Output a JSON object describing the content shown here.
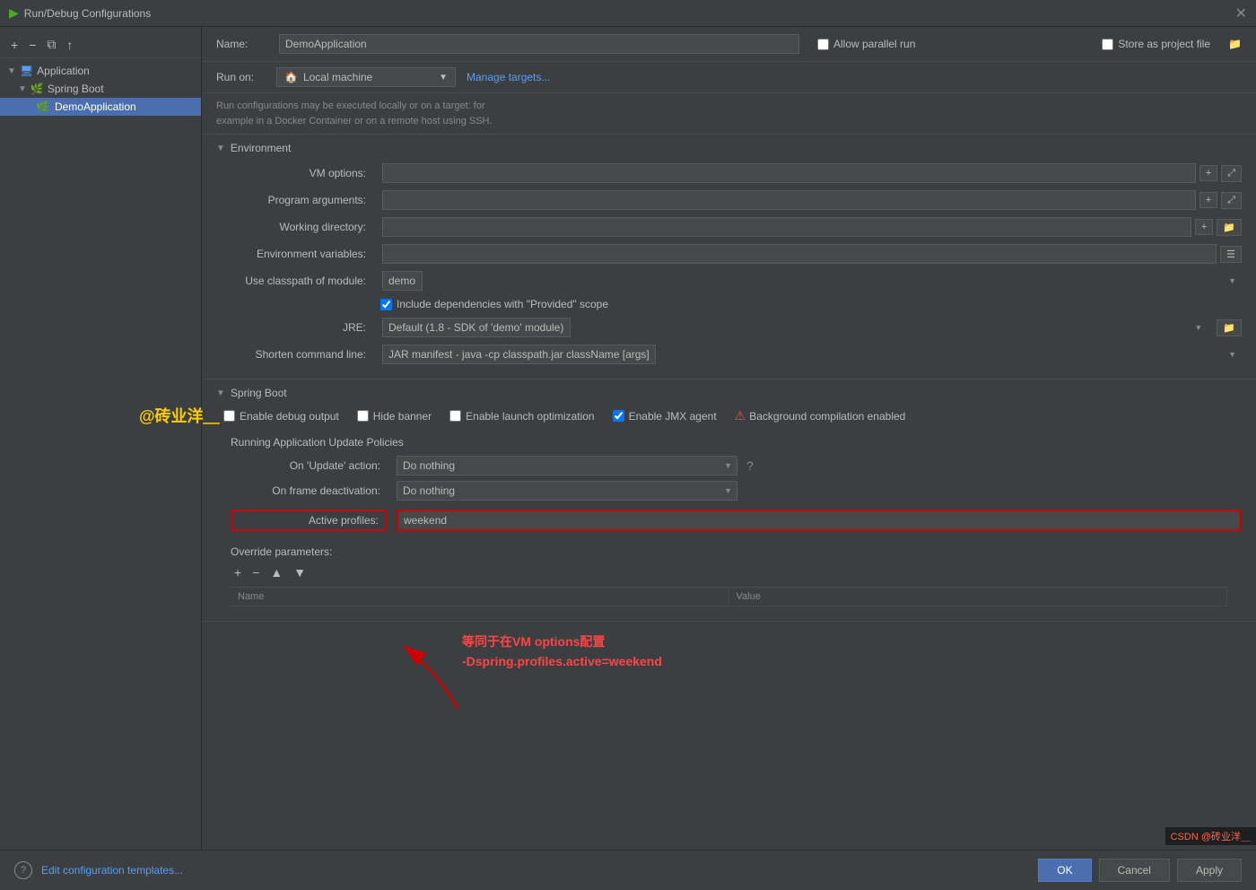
{
  "titleBar": {
    "title": "Run/Debug Configurations",
    "closeBtn": "✕"
  },
  "sidebar": {
    "toolbar": {
      "addBtn": "+",
      "removeBtn": "−",
      "copyBtn": "⧉",
      "moveUpBtn": "↑"
    },
    "items": [
      {
        "id": "application",
        "label": "Application",
        "icon": "🖥",
        "type": "group",
        "expanded": true
      },
      {
        "id": "springboot",
        "label": "Spring Boot",
        "icon": "🌿",
        "type": "group",
        "expanded": true
      },
      {
        "id": "demoapplication",
        "label": "DemoApplication",
        "icon": "🌿",
        "type": "item",
        "selected": true
      }
    ]
  },
  "header": {
    "nameLabel": "Name:",
    "nameValue": "DemoApplication",
    "allowParallelLabel": "Allow parallel run",
    "storeAsProjectLabel": "Store as project file"
  },
  "runOn": {
    "label": "Run on:",
    "target": "Local machine",
    "manageTargets": "Manage targets...",
    "infoText1": "Run configurations may be executed locally or on a target: for",
    "infoText2": "example in a Docker Container or on a remote host using SSH."
  },
  "environment": {
    "sectionTitle": "Environment",
    "vmOptionsLabel": "VM options:",
    "programArgumentsLabel": "Program arguments:",
    "workingDirectoryLabel": "Working directory:",
    "envVariablesLabel": "Environment variables:",
    "classpathLabel": "Use classpath of module:",
    "classpathValue": "demo",
    "includeDepsLabel": "Include dependencies with \"Provided\" scope",
    "jreLabel": "JRE:",
    "jreValue": "Default",
    "jreSuffix": "(1.8 - SDK of 'demo' module)",
    "shortenCmdLabel": "Shorten command line:",
    "shortenCmdValue": "JAR manifest",
    "shortenCmdSuffix": "- java -cp classpath.jar className [args]"
  },
  "springBoot": {
    "sectionTitle": "Spring Boot",
    "enableDebugLabel": "Enable debug output",
    "hideBannerLabel": "Hide banner",
    "enableLaunchLabel": "Enable launch optimization",
    "enableJmxLabel": "Enable JMX agent",
    "bgCompilationLabel": "Background compilation enabled",
    "updatePoliciesTitle": "Running Application Update Policies",
    "onUpdateLabel": "On 'Update' action:",
    "onUpdateValue": "Do nothing",
    "onFrameLabel": "On frame deactivation:",
    "onFrameValue": "Do nothing",
    "activeProfilesLabel": "Active profiles:",
    "activeProfilesValue": "weekend",
    "overrideParamsTitle": "Override parameters:",
    "addBtn": "+",
    "removeBtn": "−",
    "moveUpBtn": "▲",
    "moveDownBtn": "▼",
    "tableNameCol": "Name",
    "tableValueCol": "Value"
  },
  "annotation": {
    "watermark": "@砖业洋＿",
    "arrowText": "等同于在VM options配置\n-Dspring.profiles.active=weekend"
  },
  "bottomBar": {
    "editConfigLink": "Edit configuration templates...",
    "helpBtn": "?",
    "okBtn": "OK",
    "cancelBtn": "Cancel",
    "applyBtn": "Apply"
  },
  "colors": {
    "accent": "#4b6eaf",
    "link": "#589df6",
    "bg": "#3c3f41",
    "inputBg": "#45494a",
    "border": "#5a5a5a",
    "text": "#bbbbbb",
    "red": "#cc0000",
    "green": "#4eaa25",
    "warning": "#cc3333"
  }
}
